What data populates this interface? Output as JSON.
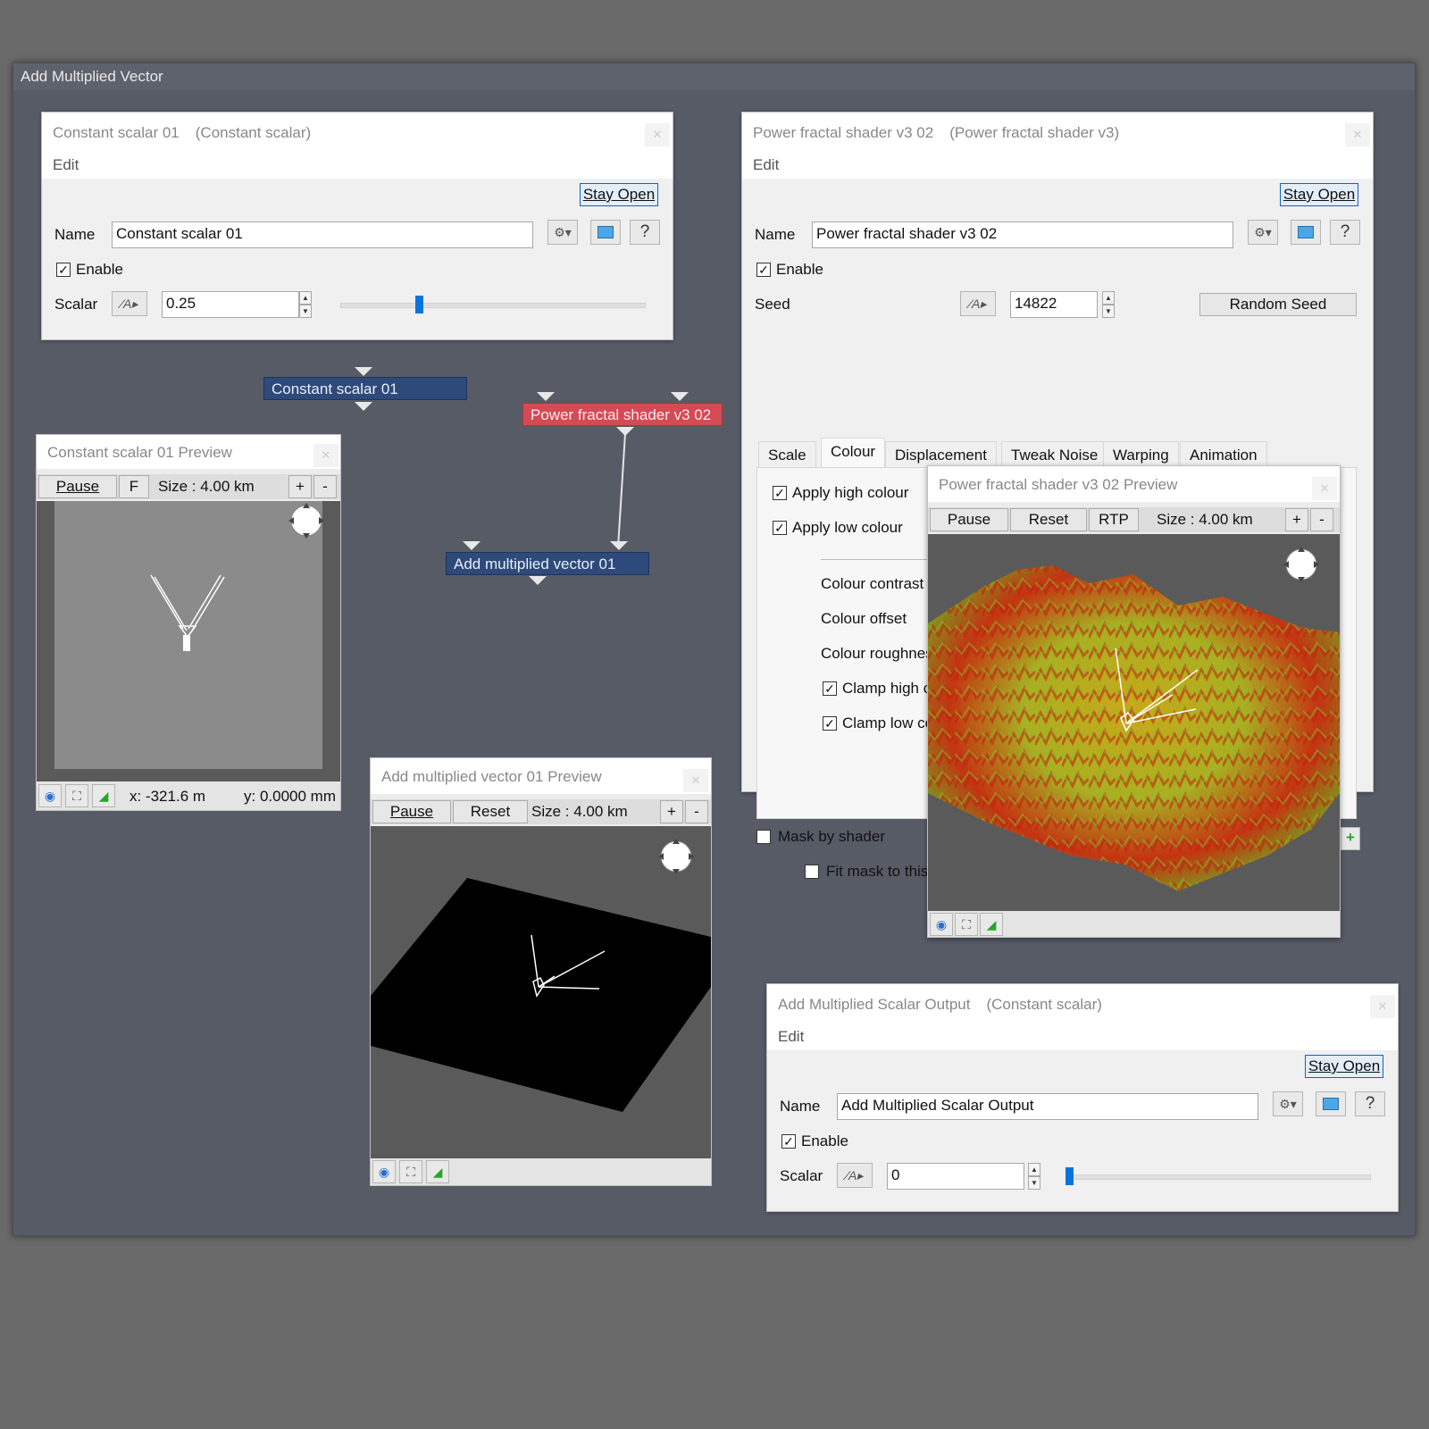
{
  "window": {
    "title": "Add Multiplied Vector"
  },
  "constant_panel": {
    "title": "Constant scalar 01",
    "subtitle": "(Constant scalar)",
    "menu": "Edit",
    "stay_open": "Stay Open",
    "name_label": "Name",
    "name_value": "Constant scalar 01",
    "help": "?",
    "enable_label": "Enable",
    "enabled": true,
    "scalar_label": "Scalar",
    "scalar_value": "0.25",
    "slider_fraction": 0.25
  },
  "power_panel": {
    "title": "Power fractal shader v3 02",
    "subtitle": "(Power fractal shader v3)",
    "menu": "Edit",
    "stay_open": "Stay Open",
    "name_label": "Name",
    "name_value": "Power fractal shader v3 02",
    "help": "?",
    "enable_label": "Enable",
    "seed_label": "Seed",
    "seed_value": "14822",
    "random_seed": "Random Seed",
    "tabs": [
      "Scale",
      "Colour",
      "Displacement",
      "Tweak Noise",
      "Warping",
      "Animation"
    ],
    "active_tab": "Colour",
    "apply_high_label": "Apply high colour",
    "apply_high_value": "1",
    "high_colour": "#e81010",
    "apply_low_label": "Apply low colour",
    "apply_low_value": "1",
    "low_colour": "#10d010",
    "colour_contrast": "Colour contrast",
    "colour_offset": "Colour offset",
    "colour_roughness": "Colour roughness",
    "clamp_high": "Clamp high colour",
    "clamp_low": "Clamp low colour",
    "mask_by_shader": "Mask by shader",
    "fit_mask": "Fit mask to this shader"
  },
  "nodes": {
    "constant": "Constant scalar 01",
    "power": "Power fractal shader v3 02",
    "add_vector": "Add multiplied vector 01"
  },
  "constant_preview": {
    "title": "Constant scalar 01 Preview",
    "pause": "Pause",
    "truncated_btn": "F",
    "size": "Size : 4.00 km",
    "plus": "+",
    "minus": "-",
    "x_readout": "x: -321.6 m",
    "y_readout": "y: 0.0000 mm"
  },
  "add_preview": {
    "title": "Add multiplied vector 01 Preview",
    "pause": "Pause",
    "reset": "Reset",
    "size": "Size : 4.00 km",
    "plus": "+",
    "minus": "-"
  },
  "power_preview": {
    "title": "Power fractal shader v3 02 Preview",
    "pause": "Pause",
    "reset": "Reset",
    "rtp": "RTP",
    "size": "Size : 4.00 km",
    "plus": "+",
    "minus": "-"
  },
  "output_panel": {
    "title": "Add Multiplied Scalar Output",
    "subtitle": "(Constant scalar)",
    "menu": "Edit",
    "stay_open": "Stay Open",
    "name_label": "Name",
    "name_value": "Add Multiplied Scalar Output",
    "help": "?",
    "enable_label": "Enable",
    "scalar_label": "Scalar",
    "scalar_value": "0",
    "slider_fraction": 0.0
  },
  "icons": {
    "close": "close-icon",
    "gear": "gear-icon",
    "window": "window-icon",
    "curve": "curve-menu-icon",
    "eye": "eye-icon",
    "frame": "frame-icon",
    "graph": "graph-icon",
    "compass": "compass-icon"
  }
}
